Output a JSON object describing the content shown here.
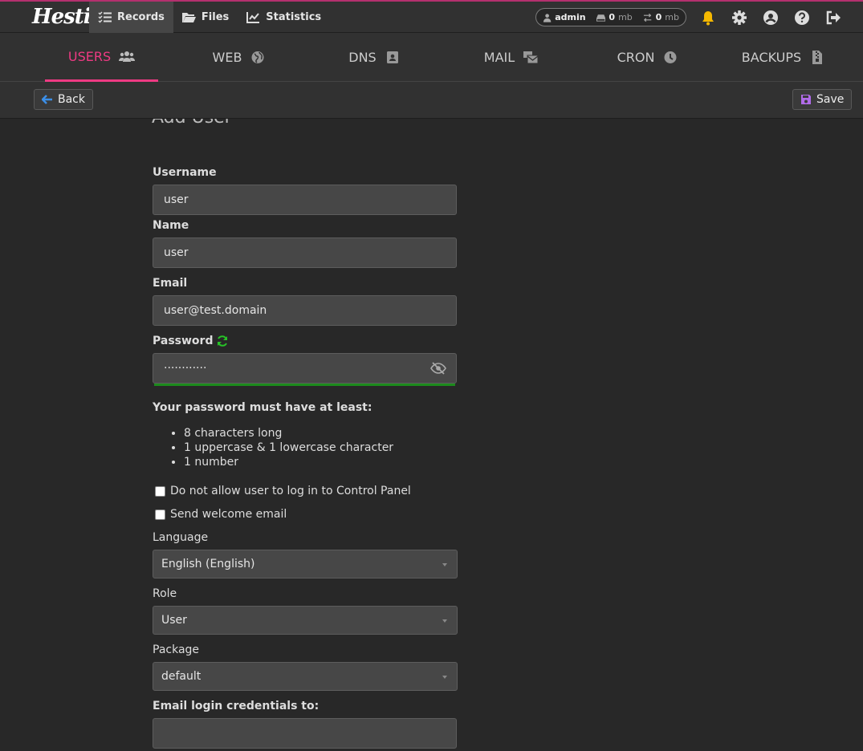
{
  "brand": {
    "logo_text": "Hestia"
  },
  "topnav": [
    {
      "label": "Records",
      "icon": "list-check-icon",
      "active": true
    },
    {
      "label": "Files",
      "icon": "folder-open-icon",
      "active": false
    },
    {
      "label": "Statistics",
      "icon": "chart-line-icon",
      "active": false
    }
  ],
  "user_stats": {
    "username": "admin",
    "disk_value": "0",
    "disk_unit": "mb",
    "bandwidth_value": "0",
    "bandwidth_unit": "mb"
  },
  "topicons": [
    "bell-icon",
    "gear-icon",
    "user-circle-icon",
    "question-circle-icon",
    "logout-icon"
  ],
  "tabs": [
    {
      "label": "USERS",
      "icon": "users-icon",
      "active": true
    },
    {
      "label": "WEB",
      "icon": "globe-icon",
      "active": false
    },
    {
      "label": "DNS",
      "icon": "address-book-icon",
      "active": false
    },
    {
      "label": "MAIL",
      "icon": "mail-bulk-icon",
      "active": false
    },
    {
      "label": "CRON",
      "icon": "clock-icon",
      "active": false
    },
    {
      "label": "BACKUPS",
      "icon": "file-zipper-icon",
      "active": false
    }
  ],
  "toolbar": {
    "back_label": "Back",
    "save_label": "Save"
  },
  "form": {
    "title": "Add User",
    "username_label": "Username",
    "username_value": "user",
    "name_label": "Name",
    "name_value": "user",
    "email_label": "Email",
    "email_value": "user@test.domain",
    "password_label": "Password",
    "password_value": "············",
    "password_hint": "Your password must have at least:",
    "password_rules": [
      "8 characters long",
      "1 uppercase & 1 lowercase character",
      "1 number"
    ],
    "no_login_label": "Do not allow user to log in to Control Panel",
    "welcome_email_label": "Send welcome email",
    "language_label": "Language",
    "language_value": "English (English)",
    "role_label": "Role",
    "role_value": "User",
    "package_label": "Package",
    "package_value": "default",
    "email_creds_label": "Email login credentials to:",
    "email_creds_value": ""
  },
  "colors": {
    "accent": "#ee3a83",
    "strength_bar": "#1c8a1c",
    "bell": "#f5b800"
  }
}
